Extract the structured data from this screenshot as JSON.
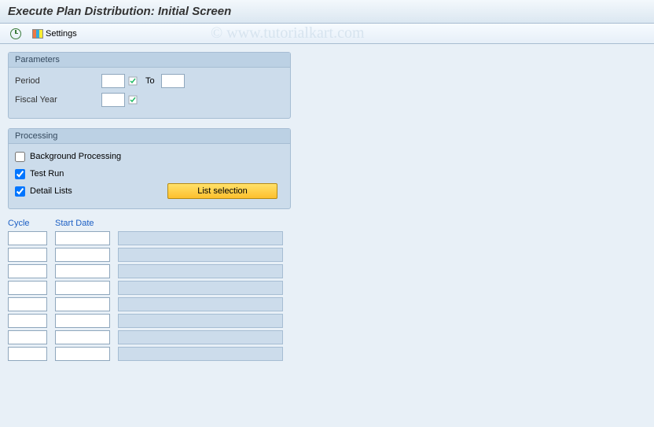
{
  "title": "Execute Plan Distribution: Initial Screen",
  "watermark": "© www.tutorialkart.com",
  "toolbar": {
    "settings_label": "Settings"
  },
  "parameters": {
    "group_title": "Parameters",
    "period_label": "Period",
    "period_from": "",
    "to_label": "To",
    "period_to": "",
    "fiscal_year_label": "Fiscal Year",
    "fiscal_year": ""
  },
  "processing": {
    "group_title": "Processing",
    "background_label": "Background Processing",
    "background_checked": false,
    "testrun_label": "Test Run",
    "testrun_checked": true,
    "detail_label": "Detail Lists",
    "detail_checked": true,
    "list_selection_label": "List selection"
  },
  "columns": {
    "cycle": "Cycle",
    "start_date": "Start Date"
  },
  "rows": [
    {
      "cycle": "",
      "start": "",
      "desc": ""
    },
    {
      "cycle": "",
      "start": "",
      "desc": ""
    },
    {
      "cycle": "",
      "start": "",
      "desc": ""
    },
    {
      "cycle": "",
      "start": "",
      "desc": ""
    },
    {
      "cycle": "",
      "start": "",
      "desc": ""
    },
    {
      "cycle": "",
      "start": "",
      "desc": ""
    },
    {
      "cycle": "",
      "start": "",
      "desc": ""
    },
    {
      "cycle": "",
      "start": "",
      "desc": ""
    }
  ]
}
